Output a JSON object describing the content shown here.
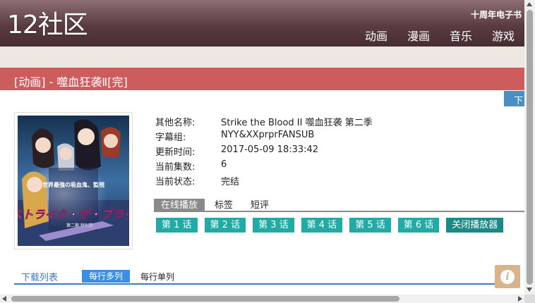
{
  "header": {
    "logo": "12社区",
    "tagline": "十周年电子书",
    "nav": [
      "动画",
      "漫画",
      "音乐",
      "游戏"
    ]
  },
  "page_title": "[动画] - 噬血狂袭Ⅱ[完]",
  "download_tab": "下",
  "details": [
    {
      "key": "其他名称:",
      "value": "Strike the Blood II 噬血狂袭 第二季"
    },
    {
      "key": "字幕组:",
      "value": "NYY&XXprprFANSUB"
    },
    {
      "key": "更新时间:",
      "value": "2017-05-09 18:33:42"
    },
    {
      "key": "当前集数:",
      "value": "6"
    },
    {
      "key": "当前状态:",
      "value": "完结"
    }
  ],
  "tabs": {
    "online": "在线播放",
    "tags": "标签",
    "short_review": "短评"
  },
  "episodes": [
    "第 1 话",
    "第 2 话",
    "第 3 话",
    "第 4 话",
    "第 5 话",
    "第 6 话"
  ],
  "close_player": "关闭播放器",
  "download_list": {
    "label": "下载列表",
    "multi": "每行多列",
    "single": "每行单列"
  },
  "colors": {
    "header": "#5a3c41",
    "title_bar": "#cd5c5c",
    "episode": "#22aaa5",
    "accent_blue": "#3a7ebf"
  },
  "icons": {
    "info": "info-icon"
  }
}
